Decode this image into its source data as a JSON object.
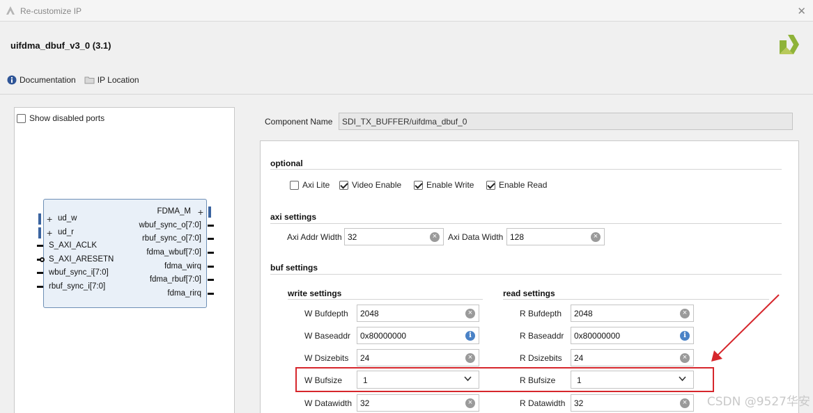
{
  "window": {
    "title": "Re-customize IP"
  },
  "ip": {
    "name": "uifdma_dbuf_v3_0 (3.1)"
  },
  "toolbar": {
    "documentation": "Documentation",
    "ip_location": "IP Location"
  },
  "left_panel": {
    "show_disabled_ports": "Show disabled ports",
    "left_ports": [
      "ud_w",
      "ud_r",
      "S_AXI_ACLK",
      "S_AXI_ARESETN",
      "wbuf_sync_i[7:0]",
      "rbuf_sync_i[7:0]"
    ],
    "right_ports": [
      "FDMA_M",
      "wbuf_sync_o[7:0]",
      "rbuf_sync_o[7:0]",
      "fdma_wbuf[7:0]",
      "fdma_wirq",
      "fdma_rbuf[7:0]",
      "fdma_rirq"
    ]
  },
  "component": {
    "label": "Component Name",
    "value": "SDI_TX_BUFFER/uifdma_dbuf_0"
  },
  "optional": {
    "title": "optional",
    "options": [
      {
        "label": "Axi Lite",
        "checked": false
      },
      {
        "label": "Video Enable",
        "checked": true
      },
      {
        "label": "Enable Write",
        "checked": true
      },
      {
        "label": "Enable Read",
        "checked": true
      }
    ]
  },
  "axi": {
    "title": "axi settings",
    "addr_label": "Axi Addr Width",
    "addr_value": "32",
    "data_label": "Axi Data Width",
    "data_value": "128"
  },
  "buf": {
    "title": "buf settings",
    "write_title": "write settings",
    "read_title": "read settings",
    "write": [
      {
        "label": "W Bufdepth",
        "value": "2048",
        "icon": "clear"
      },
      {
        "label": "W Baseaddr",
        "value": "0x80000000",
        "icon": "info"
      },
      {
        "label": "W Dsizebits",
        "value": "24",
        "icon": "clear"
      },
      {
        "label": "W Bufsize",
        "value": "1",
        "icon": "dropdown"
      },
      {
        "label": "W Datawidth",
        "value": "32",
        "icon": "clear"
      }
    ],
    "read": [
      {
        "label": "R Bufdepth",
        "value": "2048",
        "icon": "clear"
      },
      {
        "label": "R Baseaddr",
        "value": "0x80000000",
        "icon": "info"
      },
      {
        "label": "R Dsizebits",
        "value": "24",
        "icon": "clear"
      },
      {
        "label": "R Bufsize",
        "value": "1",
        "icon": "dropdown"
      },
      {
        "label": "R Datawidth",
        "value": "32",
        "icon": "clear"
      }
    ]
  },
  "watermark": "CSDN @9527华安",
  "colors": {
    "highlight": "#d6262c",
    "accent": "#4a82c6"
  }
}
